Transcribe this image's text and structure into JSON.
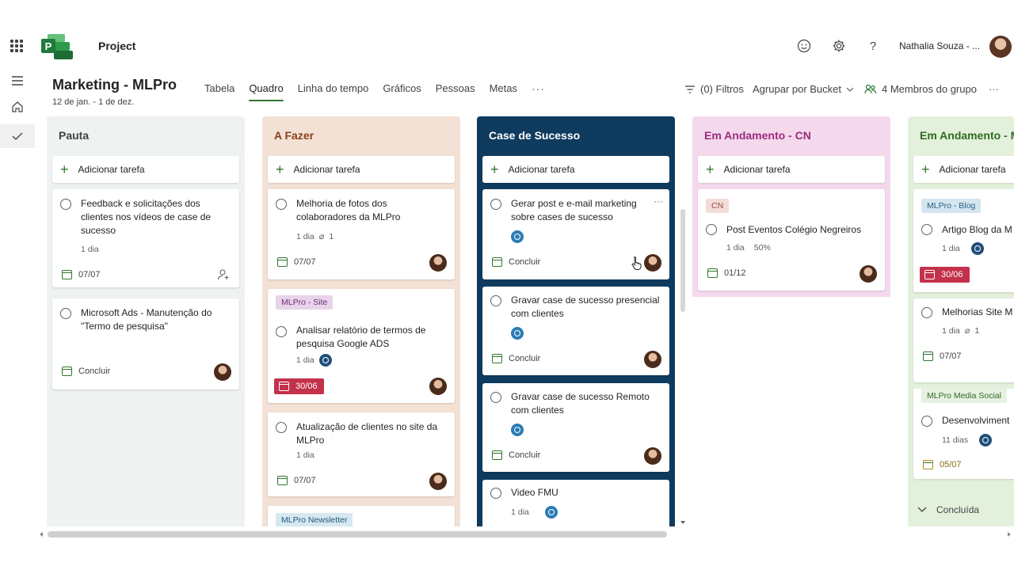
{
  "app": {
    "name": "Project",
    "user": "Nathalia Souza - ..."
  },
  "plan": {
    "title": "Marketing - MLPro",
    "dates": "12 de jan. - 1 de dez."
  },
  "tabs": [
    "Tabela",
    "Quadro",
    "Linha do tempo",
    "Gráficos",
    "Pessoas",
    "Metas"
  ],
  "active_tab": "Quadro",
  "tab_more": "···",
  "header_actions": {
    "filters": "(0) Filtros",
    "group_by": "Agrupar por Bucket",
    "members": "4 Membros do grupo",
    "more": "···"
  },
  "add_task_label": "Adicionar tarefa",
  "colors": {
    "accent": "#31752f",
    "brand_dark_blue": "#0f3b5f",
    "overdue": "#c4314b"
  },
  "columns": [
    {
      "title": "Pauta",
      "cards": [
        {
          "title": "Feedback e solicitações dos clientes nos vídeos de case de sucesso",
          "meta": "1 dia",
          "date": "07/07",
          "assign_icon": "add-person-icon"
        },
        {
          "title": "Microsoft Ads - Manutenção do \"Termo de pesquisa\"",
          "footer": "Concluir"
        }
      ]
    },
    {
      "title": "A Fazer",
      "cards": [
        {
          "title": "Melhoria de fotos dos colaboradores da MLPro",
          "meta": "1 dia",
          "attachments": "1",
          "date": "07/07"
        },
        {
          "label": "MLPro - Site",
          "title": "Analisar relatório de termos de pesquisa Google ADS",
          "meta": "1 dia",
          "date": "30/06"
        },
        {
          "title": "Atualização de clientes no site da MLPro",
          "meta": "1 dia",
          "date": "07/07"
        },
        {
          "label": "MLPro Newsletter"
        }
      ]
    },
    {
      "title": "Case de Sucesso",
      "cards": [
        {
          "title": "Gerar post e e-mail marketing sobre cases de sucesso",
          "footer": "Concluir",
          "more": "···"
        },
        {
          "title": "Gravar case de sucesso presencial com clientes",
          "footer": "Concluir"
        },
        {
          "title": "Gravar case de sucesso Remoto com clientes",
          "footer": "Concluir"
        },
        {
          "title": "Video FMU",
          "meta": "1 dia"
        }
      ]
    },
    {
      "title": "Em Andamento - CN",
      "cards": [
        {
          "label": "CN",
          "title": "Post Eventos Colégio Negreiros",
          "meta": "1 dia",
          "progress": "50%",
          "date": "01/12"
        }
      ]
    },
    {
      "title": "Em Andamento - M",
      "cards": [
        {
          "label": "MLPro - Blog",
          "title": "Artigo Blog da M",
          "meta": "1 dia",
          "date": "30/06"
        },
        {
          "title": "Melhorias Site M",
          "meta": "1 dia",
          "attachments": "1",
          "date": "07/07"
        },
        {
          "label": "MLPro Media Social",
          "title": "Desenvolviment",
          "meta": "11 dias",
          "date": "05/07"
        }
      ],
      "completed_label": "Concluída"
    }
  ]
}
